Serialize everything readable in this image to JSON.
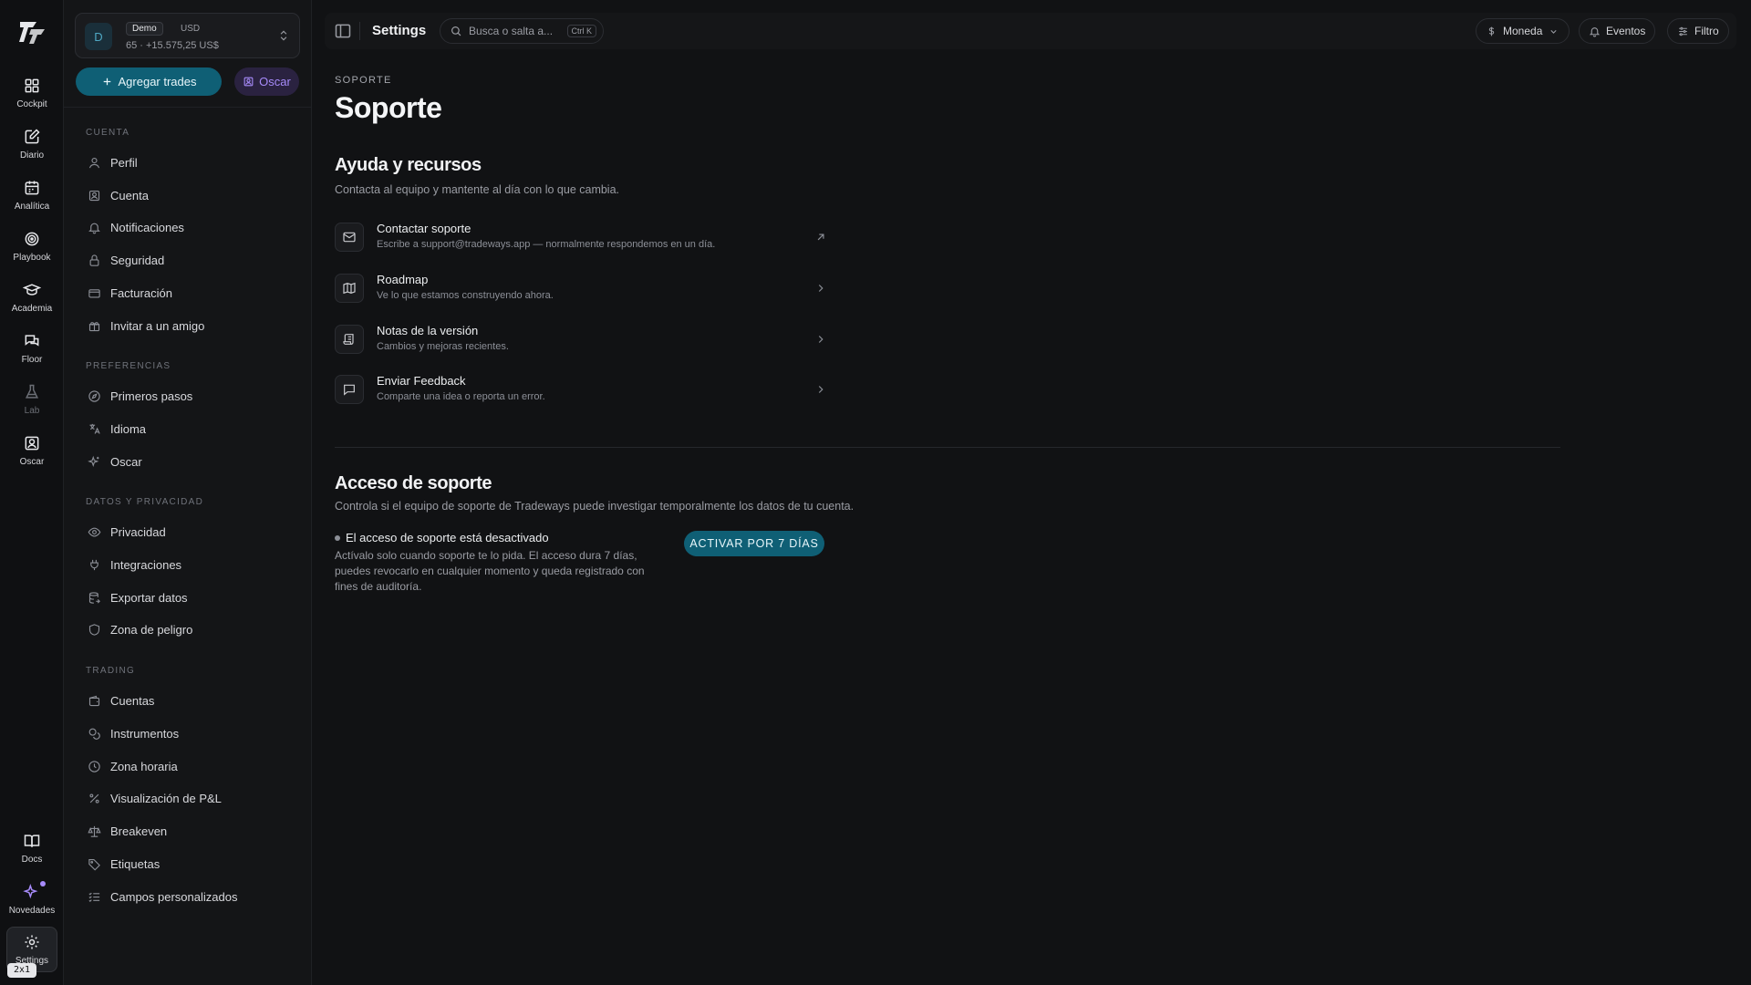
{
  "rail": {
    "items": [
      {
        "label": "Cockpit",
        "icon": "grid-icon"
      },
      {
        "label": "Diario",
        "icon": "edit-icon"
      },
      {
        "label": "Analítica",
        "icon": "calendar-icon"
      },
      {
        "label": "Playbook",
        "icon": "target-icon"
      },
      {
        "label": "Academia",
        "icon": "graduation-cap-icon"
      },
      {
        "label": "Floor",
        "icon": "chat-icon"
      },
      {
        "label": "Lab",
        "icon": "flask-icon"
      },
      {
        "label": "Oscar",
        "icon": "user-square-icon"
      }
    ],
    "bottom": [
      {
        "label": "Docs",
        "icon": "book-icon"
      },
      {
        "label": "Novedades",
        "icon": "sparkle-icon"
      },
      {
        "label": "Settings",
        "icon": "gear-icon"
      }
    ],
    "zoom": "2x1"
  },
  "account": {
    "avatar": "D",
    "tag": "Demo",
    "currency": "USD",
    "balance": "65 · +15.575,25 US$"
  },
  "actions": {
    "add_trades": "Agregar trades",
    "oscar": "Oscar"
  },
  "sidebar": {
    "sections": [
      {
        "title": "CUENTA",
        "items": [
          "Perfil",
          "Cuenta",
          "Notificaciones",
          "Seguridad",
          "Facturación",
          "Invitar a un amigo"
        ]
      },
      {
        "title": "PREFERENCIAS",
        "items": [
          "Primeros pasos",
          "Idioma",
          "Oscar"
        ]
      },
      {
        "title": "DATOS Y PRIVACIDAD",
        "items": [
          "Privacidad",
          "Integraciones",
          "Exportar datos",
          "Zona de peligro"
        ]
      },
      {
        "title": "TRADING",
        "items": [
          "Cuentas",
          "Instrumentos",
          "Zona horaria",
          "Visualización de P&L",
          "Breakeven",
          "Etiquetas",
          "Campos personalizados"
        ]
      }
    ]
  },
  "topbar": {
    "title": "Settings",
    "search_placeholder": "Busca o salta a...",
    "search_shortcut": "Ctrl K",
    "currency": "Moneda",
    "events": "Eventos",
    "filter": "Filtro"
  },
  "main": {
    "kicker": "SOPORTE",
    "title": "Soporte",
    "help": {
      "title": "Ayuda y recursos",
      "subtitle": "Contacta al equipo y mantente al día con lo que cambia.",
      "rows": [
        {
          "title": "Contactar soporte",
          "desc": "Escribe a support@tradeways.app — normalmente respondemos en un día.",
          "icon": "mail-icon"
        },
        {
          "title": "Roadmap",
          "desc": "Ve lo que estamos construyendo ahora.",
          "icon": "map-icon"
        },
        {
          "title": "Notas de la versión",
          "desc": "Cambios y mejoras recientes.",
          "icon": "scroll-icon"
        },
        {
          "title": "Enviar Feedback",
          "desc": "Comparte una idea o reporta un error.",
          "icon": "message-icon"
        }
      ]
    },
    "access": {
      "title": "Acceso de soporte",
      "subtitle": "Controla si el equipo de soporte de Tradeways puede investigar temporalmente los datos de tu cuenta.",
      "status": "El acceso de soporte está desactivado",
      "desc": "Actívalo solo cuando soporte te lo pida. El acceso dura 7 días, puedes revocarlo en cualquier momento y queda registrado con fines de auditoría.",
      "button": "ACTIVAR POR 7 DÍAS"
    }
  },
  "colors": {
    "accent": "#0f5f75",
    "oscar_accent": "#a78bfa",
    "background": "#111214"
  }
}
